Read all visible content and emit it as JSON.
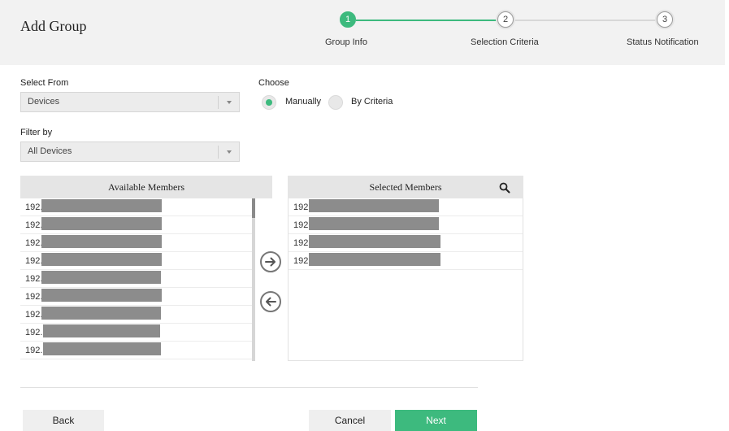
{
  "header": {
    "title": "Add Group"
  },
  "steps": [
    {
      "number": "1",
      "label": "Group Info",
      "state": "active"
    },
    {
      "number": "2",
      "label": "Selection Criteria",
      "state": "pending"
    },
    {
      "number": "3",
      "label": "Status Notification",
      "state": "pending"
    }
  ],
  "form": {
    "select_from": {
      "label": "Select From",
      "value": "Devices"
    },
    "filter_by": {
      "label": "Filter by",
      "value": "All Devices"
    },
    "choose": {
      "label": "Choose",
      "options": [
        {
          "label": "Manually",
          "selected": true
        },
        {
          "label": "By Criteria",
          "selected": false
        }
      ]
    }
  },
  "available": {
    "header": "Available Members",
    "items": [
      "192.",
      "192.",
      "192.",
      "192.",
      "192.",
      "192.",
      "192.",
      "192.",
      "192."
    ]
  },
  "selected": {
    "header": "Selected Members",
    "items": [
      "192.",
      "192.",
      "192.",
      "192."
    ]
  },
  "icons": {
    "search": "search-icon",
    "move_right": "arrow-right-circle-icon",
    "move_left": "arrow-left-circle-icon"
  },
  "buttons": {
    "back": "Back",
    "cancel": "Cancel",
    "next": "Next"
  },
  "colors": {
    "accent": "#3dba7e",
    "header_bg": "#f2f2f2",
    "redaction": "#8c8c8c"
  }
}
